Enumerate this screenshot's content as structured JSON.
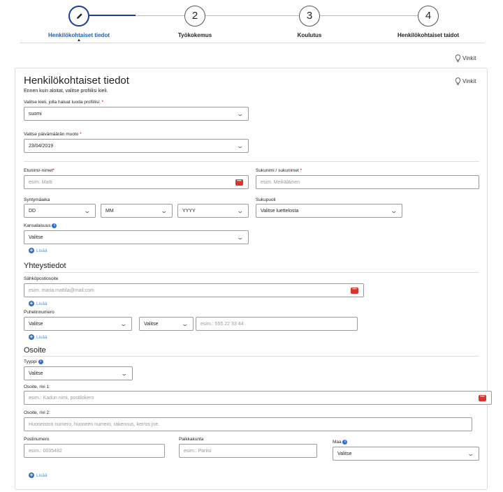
{
  "stepper": {
    "steps": [
      {
        "number": "",
        "label": "Henkilökohtaiset tiedot"
      },
      {
        "number": "2",
        "label": "Työkokemus"
      },
      {
        "number": "3",
        "label": "Koulutus"
      },
      {
        "number": "4",
        "label": "Henkilökohtaiset taidot"
      }
    ]
  },
  "tips_label": "Vinkit",
  "form": {
    "title": "Henkilökohtaiset tiedot",
    "subtitle": "Ennen kuin aloitat, valitse profiilisi kieli.",
    "language": {
      "label": "Valitse kieli, jolla haluat luoda profiilisi:",
      "value": "suomi"
    },
    "date_format": {
      "label": "Valitse päivämäärän muoto",
      "value": "23/04/2019"
    },
    "first_name": {
      "label": "Etunimi/-nimet",
      "placeholder": "esim. Matti"
    },
    "last_name": {
      "label": "Sukunimi / sukunimet",
      "placeholder": "esim. Meikäläinen"
    },
    "birth_date": {
      "label": "Syntymäaika",
      "day": "DD",
      "month": "MM",
      "year": "YYYY"
    },
    "gender": {
      "label": "Sukupuoli",
      "value": "Valitse luettelosta"
    },
    "nationality": {
      "label": "Kansalaisuus",
      "value": "Valitse"
    },
    "add_label": "Lisää",
    "contact": {
      "title": "Yhteystiedot",
      "email": {
        "label": "Sähköpostiosoite",
        "placeholder": "esim. maria.mattila@mail.com"
      },
      "phone": {
        "label": "Puhelinnumero",
        "type": "Valitse",
        "code": "Valitse",
        "placeholder": "esim.: 555 22 33 44"
      }
    },
    "address": {
      "title": "Osoite",
      "type": {
        "label": "Tyyppi",
        "value": "Valitse"
      },
      "line1": {
        "label": "Osoite, rivi 1:",
        "placeholder": "esim.: Kadun nimi, postilokero"
      },
      "line2": {
        "label": "Osoite, rivi 2:",
        "placeholder": "Huoneiston numero, huoneen numero, rakennus, kerros jne."
      },
      "postcode": {
        "label": "Postinumero",
        "placeholder": "esim.: 0035482"
      },
      "city": {
        "label": "Paikkakunta",
        "placeholder": "esim.: Pariisi"
      },
      "country": {
        "label": "Maa",
        "value": "Valitse"
      }
    }
  }
}
